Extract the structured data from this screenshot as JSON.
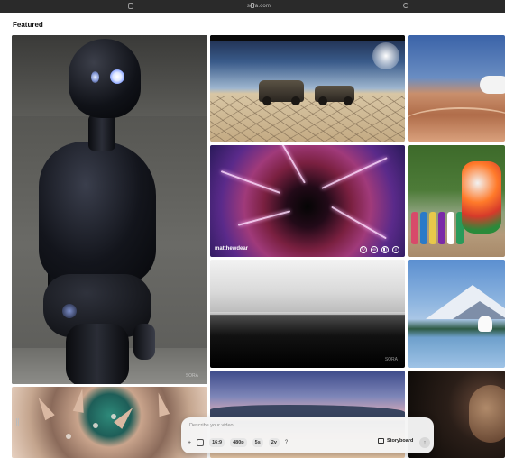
{
  "browser": {
    "url": "sora.com"
  },
  "page": {
    "section_title": "Featured"
  },
  "tiles": {
    "energy": {
      "username": "matthewdear"
    },
    "robot": {
      "watermark": "SORA"
    },
    "ocean": {
      "watermark": "SORA"
    }
  },
  "prompt_bar": {
    "placeholder": "Describe your video...",
    "plus": "+",
    "aspect_ratio": "16:9",
    "resolution": "480p",
    "duration": "5s",
    "variations": "2v",
    "help": "?",
    "storyboard": "Storyboard",
    "send": "↑"
  },
  "icons": {
    "energy_actions": [
      "refresh-icon",
      "loop-icon",
      "blend-icon",
      "search-icon"
    ]
  }
}
